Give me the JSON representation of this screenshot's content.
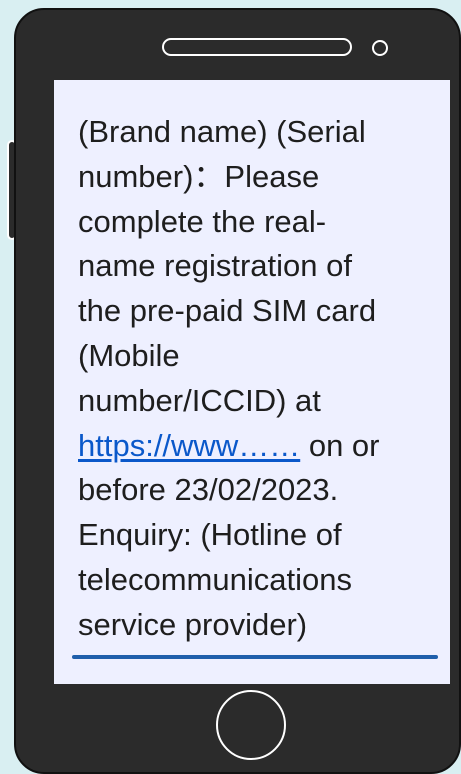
{
  "message": {
    "line_1": "(Brand name) (Serial",
    "line_2": "number)：Please",
    "line_3": "complete the real-",
    "line_4": "name registration of",
    "line_5": "the pre-paid SIM card",
    "line_6": "(Mobile",
    "line_7": "number/ICCID) at",
    "link_text": "https://www……",
    "after_link": " on or",
    "line_9": "before 23/02/2023.",
    "line_10": "Enquiry: (Hotline of",
    "line_11": "telecommunications",
    "line_12": "service provider)"
  },
  "colors": {
    "background": "#d9eff2",
    "phone_body": "#2b2b2b",
    "screen": "#eef0ff",
    "link": "#0a58ca",
    "screen_line": "#1f5fab"
  },
  "icons": [
    "speaker-icon",
    "camera-icon",
    "home-button-icon"
  ]
}
